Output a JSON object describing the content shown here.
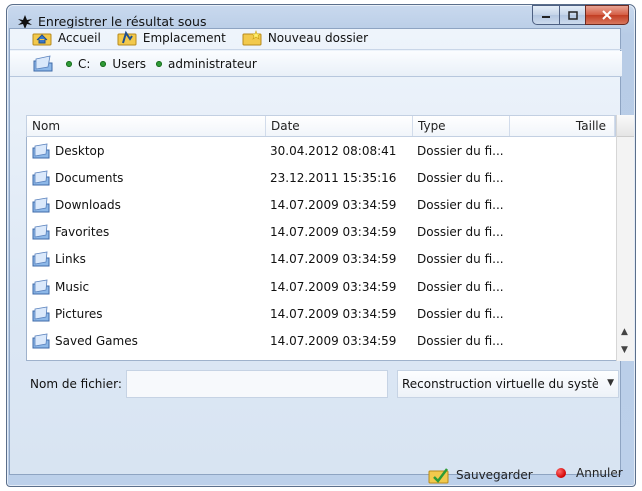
{
  "window": {
    "title": "Enregistrer le résultat sous"
  },
  "toolbar": {
    "home_label": "Accueil",
    "location_label": "Emplacement",
    "new_folder_label": "Nouveau dossier"
  },
  "path": {
    "crumbs": [
      "C:",
      "Users",
      "administrateur"
    ]
  },
  "list": {
    "columns": [
      "Nom",
      "Date",
      "Type",
      "Taille"
    ],
    "rows": [
      {
        "name": "Desktop",
        "date": "30.04.2012 08:08:41",
        "type": "Dossier du fi...",
        "size": ""
      },
      {
        "name": "Documents",
        "date": "23.12.2011 15:35:16",
        "type": "Dossier du fi...",
        "size": ""
      },
      {
        "name": "Downloads",
        "date": "14.07.2009 03:34:59",
        "type": "Dossier du fi...",
        "size": ""
      },
      {
        "name": "Favorites",
        "date": "14.07.2009 03:34:59",
        "type": "Dossier du fi...",
        "size": ""
      },
      {
        "name": "Links",
        "date": "14.07.2009 03:34:59",
        "type": "Dossier du fi...",
        "size": ""
      },
      {
        "name": "Music",
        "date": "14.07.2009 03:34:59",
        "type": "Dossier du fi...",
        "size": ""
      },
      {
        "name": "Pictures",
        "date": "14.07.2009 03:34:59",
        "type": "Dossier du fi...",
        "size": ""
      },
      {
        "name": "Saved Games",
        "date": "14.07.2009 03:34:59",
        "type": "Dossier du fi...",
        "size": ""
      }
    ]
  },
  "form": {
    "filename_label": "Nom de fichier:",
    "filename_value": "",
    "filetype_selected": "Reconstruction virtuelle du système"
  },
  "actions": {
    "save_label": "Sauvegarder",
    "cancel_label": "Annuler"
  },
  "colors": {
    "crumb_dot": "#2e9b36",
    "cancel_dot": "#d10000",
    "close_button": "#c23d23"
  }
}
